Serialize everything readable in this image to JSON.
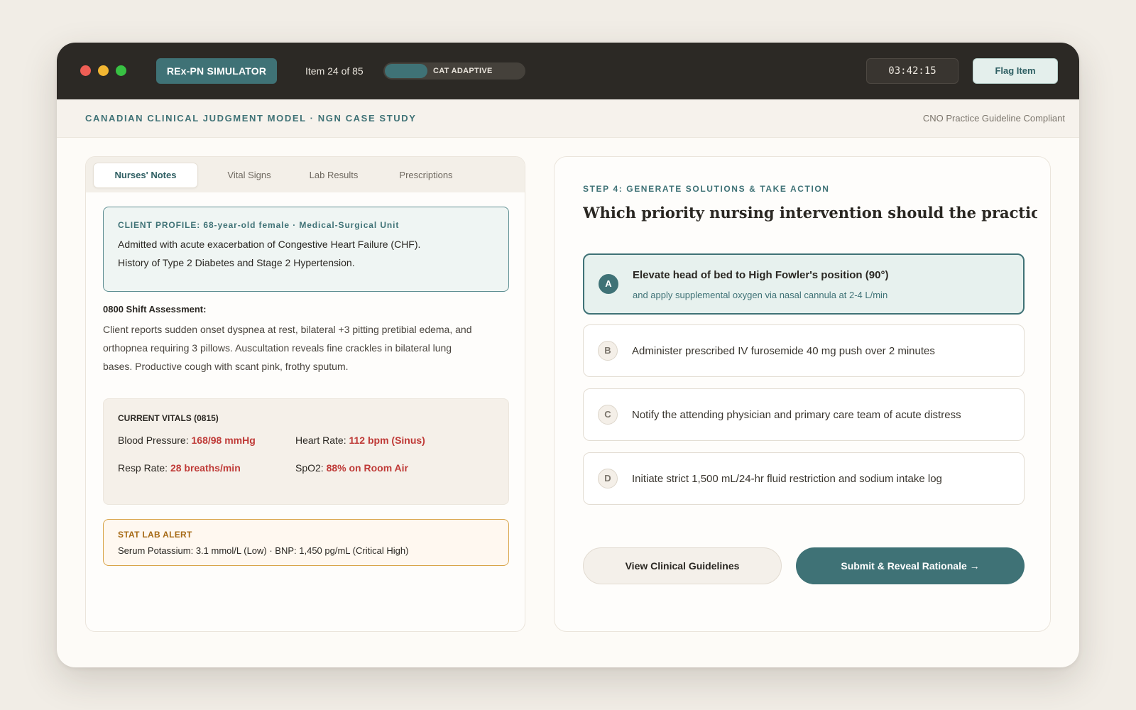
{
  "titlebar": {
    "brand": "REx-PN SIMULATOR",
    "item_count": "Item 24 of 85",
    "adaptive_label": "CAT ADAPTIVE",
    "timer": "03:42:15",
    "flag_label": "Flag Item"
  },
  "subheader": {
    "model_title": "CANADIAN CLINICAL JUDGMENT MODEL · NGN CASE STUDY",
    "compliance": "CNO Practice Guideline Compliant"
  },
  "tabs": [
    {
      "label": "Nurses' Notes",
      "active": true
    },
    {
      "label": "Vital Signs",
      "active": false
    },
    {
      "label": "Lab Results",
      "active": false
    },
    {
      "label": "Prescriptions",
      "active": false
    }
  ],
  "profile": {
    "label": "CLIENT PROFILE: 68-year-old female · Medical-Surgical Unit",
    "line1": "Admitted with acute exacerbation of Congestive Heart Failure (CHF).",
    "line2": "History of Type 2 Diabetes and Stage 2 Hypertension."
  },
  "assessment": {
    "title": "0800 Shift Assessment:",
    "text": "Client reports sudden onset dyspnea at rest, bilateral +3 pitting pretibial edema, and orthopnea requiring 3 pillows. Auscultation reveals fine crackles in bilateral lung bases. Productive cough with scant pink, frothy sputum."
  },
  "vitals": {
    "title": "CURRENT VITALS (0815)",
    "bp_label": "Blood Pressure:",
    "bp_value": "168/98 mmHg",
    "hr_label": "Heart Rate:",
    "hr_value": "112 bpm (Sinus)",
    "rr_label": "Resp Rate:",
    "rr_value": "28 breaths/min",
    "spo2_label": "SpO2:",
    "spo2_value": "88% on Room Air",
    "value_color": "#bf3a37"
  },
  "lab_alert": {
    "title": "STAT LAB ALERT",
    "text": "Serum Potassium: 3.1 mmol/L (Low) · BNP: 1,450 pg/mL (Critical High)"
  },
  "question": {
    "step_label": "STEP 4: GENERATE SOLUTIONS & TAKE ACTION",
    "text": "Which priority nursing intervention should the practical nurse implement first?"
  },
  "options": [
    {
      "letter": "A",
      "main": "Elevate head of bed to High Fowler's position (90°)",
      "sub": "and apply supplemental oxygen via nasal cannula at 2-4 L/min",
      "selected": true
    },
    {
      "letter": "B",
      "main": "Administer prescribed IV furosemide 40 mg push over 2 minutes",
      "selected": false
    },
    {
      "letter": "C",
      "main": "Notify the attending physician and primary care team of acute distress",
      "selected": false
    },
    {
      "letter": "D",
      "main": "Initiate strict 1,500 mL/24-hr fluid restriction and sodium intake log",
      "selected": false
    }
  ],
  "actions": {
    "guidelines_label": "View Clinical Guidelines",
    "submit_label": "Submit & Reveal Rationale →"
  },
  "colors": {
    "accent": "#3f7276",
    "titlebar": "#2c2925",
    "alert": "#d9a54a",
    "critical": "#bf3a37"
  }
}
